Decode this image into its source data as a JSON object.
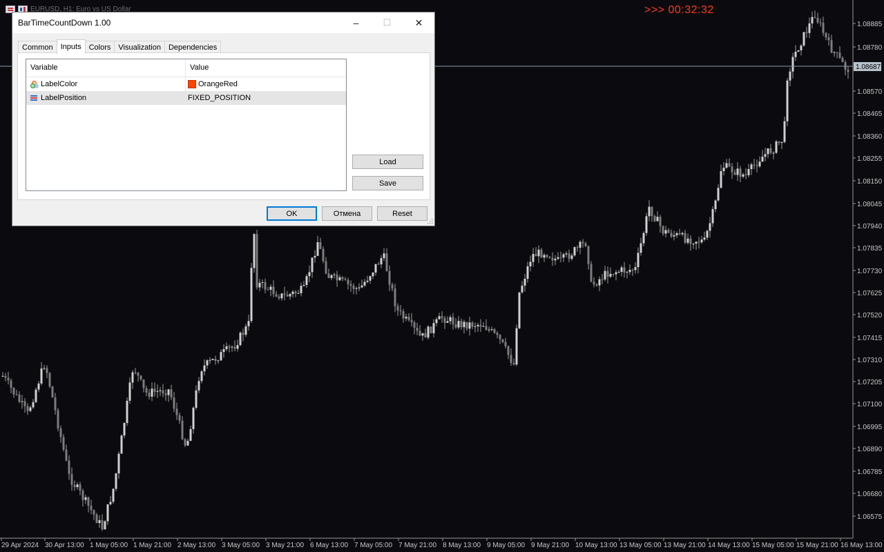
{
  "chart": {
    "title": "EURUSD, H1:  Euro vs US Dollar",
    "countdown": ">>> 00:32:32",
    "current_price": "1.08687",
    "price_levels": [
      "1.08885",
      "1.08780",
      "1.08687",
      "1.08570",
      "1.08465",
      "1.08360",
      "1.08255",
      "1.08150",
      "1.08045",
      "1.07940",
      "1.07835",
      "1.07730",
      "1.07625",
      "1.07520",
      "1.07415",
      "1.07310",
      "1.07205",
      "1.07100",
      "1.06995",
      "1.06890",
      "1.06785",
      "1.06680",
      "1.06575"
    ],
    "time_labels": [
      "29 Apr 2024",
      "30 Apr 13:00",
      "1 May 05:00",
      "1 May 21:00",
      "2 May 13:00",
      "3 May 05:00",
      "3 May 21:00",
      "6 May 13:00",
      "7 May 05:00",
      "7 May 21:00",
      "8 May 13:00",
      "9 May 05:00",
      "9 May 21:00",
      "10 May 13:00",
      "13 May 05:00",
      "13 May 21:00",
      "14 May 13:00",
      "15 May 05:00",
      "15 May 21:00",
      "16 May 13:00"
    ],
    "colors": {
      "background": "#0b0b0f",
      "candle": "#bdbdbd",
      "countdown": "#ff3b1a",
      "price_line": "#8a9aac"
    }
  },
  "dialog": {
    "title": "BarTimeCountDown 1.00",
    "tabs": [
      "Common",
      "Inputs",
      "Colors",
      "Visualization",
      "Dependencies"
    ],
    "active_tab": "Inputs",
    "columns": {
      "variable": "Variable",
      "value": "Value"
    },
    "params": [
      {
        "name": "LabelColor",
        "value": "OrangeRed",
        "icon": "color-palette-icon",
        "swatch": "#ff4500"
      },
      {
        "name": "LabelPosition",
        "value": "FIXED_POSITION",
        "icon": "enum-list-icon"
      }
    ],
    "buttons": {
      "load": "Load",
      "save": "Save",
      "ok": "OK",
      "cancel": "Отмена",
      "reset": "Reset"
    },
    "window_controls": {
      "minimize": "–",
      "maximize": "☐",
      "close": "✕"
    }
  }
}
